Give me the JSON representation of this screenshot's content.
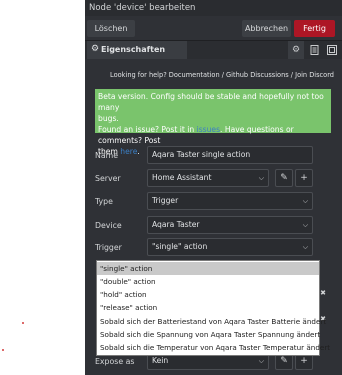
{
  "window": {
    "title": "Node 'device' bearbeiten"
  },
  "toolbar": {
    "delete_label": "Löschen",
    "cancel_label": "Abbrechen",
    "done_label": "Fertig"
  },
  "tabs": {
    "properties_label": "Eigenschaften",
    "icon_names": [
      "gear-icon",
      "document-icon",
      "node-appearance-icon"
    ]
  },
  "help": {
    "text": "Looking for help? Documentation / Github Discussions / Join Discord"
  },
  "banner": {
    "line1": "Beta version. Config should be stable and hopefully not too many",
    "line2": "bugs.",
    "line3_pre": "Found an issue? Post it in ",
    "line3_link": "issues",
    "line3_post": ". Have questions or comments? Post",
    "line4_pre": "them ",
    "line4_link": "here",
    "line4_post": ".",
    "color": "#7ac46c"
  },
  "form": {
    "name": {
      "label": "Name",
      "value": "Aqara Taster single action"
    },
    "server": {
      "label": "Server",
      "value": "Home Assistant"
    },
    "type": {
      "label": "Type",
      "value": "Trigger"
    },
    "device": {
      "label": "Device",
      "value": "Aqara Taster"
    },
    "trigger": {
      "label": "Trigger",
      "value": "\"single\" action"
    },
    "expose_as": {
      "label": "Expose as",
      "value": "Kein"
    }
  },
  "trigger_options": [
    "\"single\" action",
    "\"double\" action",
    "\"hold\" action",
    "\"release\" action",
    "Sobald sich der Batteriestand von Aqara Taster Batterie ändert",
    "Sobald sich die Spannung von Aqara Taster Spannung ändert",
    "Sobald sich die Temperatur von Aqara Taster Temperatur ändert"
  ],
  "colors": {
    "accent": "#ad1625",
    "panel": "#2f3136",
    "highlight": "#c9c9c9"
  }
}
